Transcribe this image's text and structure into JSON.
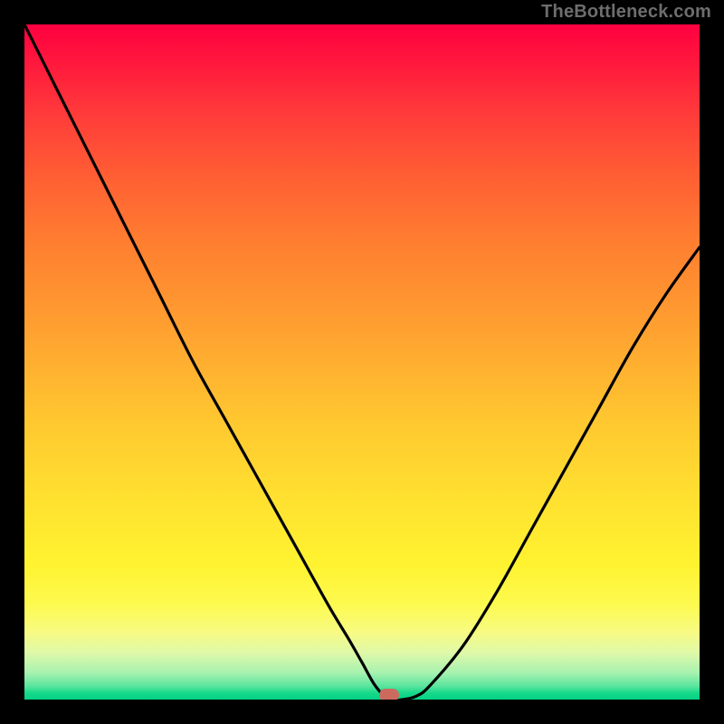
{
  "watermark": "TheBottleneck.com",
  "colors": {
    "frame": "#000000",
    "curve": "#000000",
    "marker": "#cc6a5f",
    "gradient_top": "#ff0040",
    "gradient_bottom": "#04d184"
  },
  "chart_data": {
    "type": "line",
    "title": "",
    "xlabel": "",
    "ylabel": "",
    "xlim": [
      0,
      100
    ],
    "ylim": [
      0,
      100
    ],
    "x": [
      0,
      5,
      10,
      15,
      20,
      25,
      30,
      35,
      40,
      45,
      48,
      50,
      52,
      54,
      56,
      58,
      60,
      65,
      70,
      75,
      80,
      85,
      90,
      95,
      100
    ],
    "values": [
      100,
      90,
      80,
      70,
      60,
      50,
      41,
      32,
      23,
      14,
      9,
      5.5,
      2,
      0,
      0,
      0.5,
      2,
      8,
      16,
      25,
      34,
      43,
      52,
      60,
      67
    ],
    "marker": {
      "x": 54,
      "y": 0
    },
    "annotations": []
  }
}
